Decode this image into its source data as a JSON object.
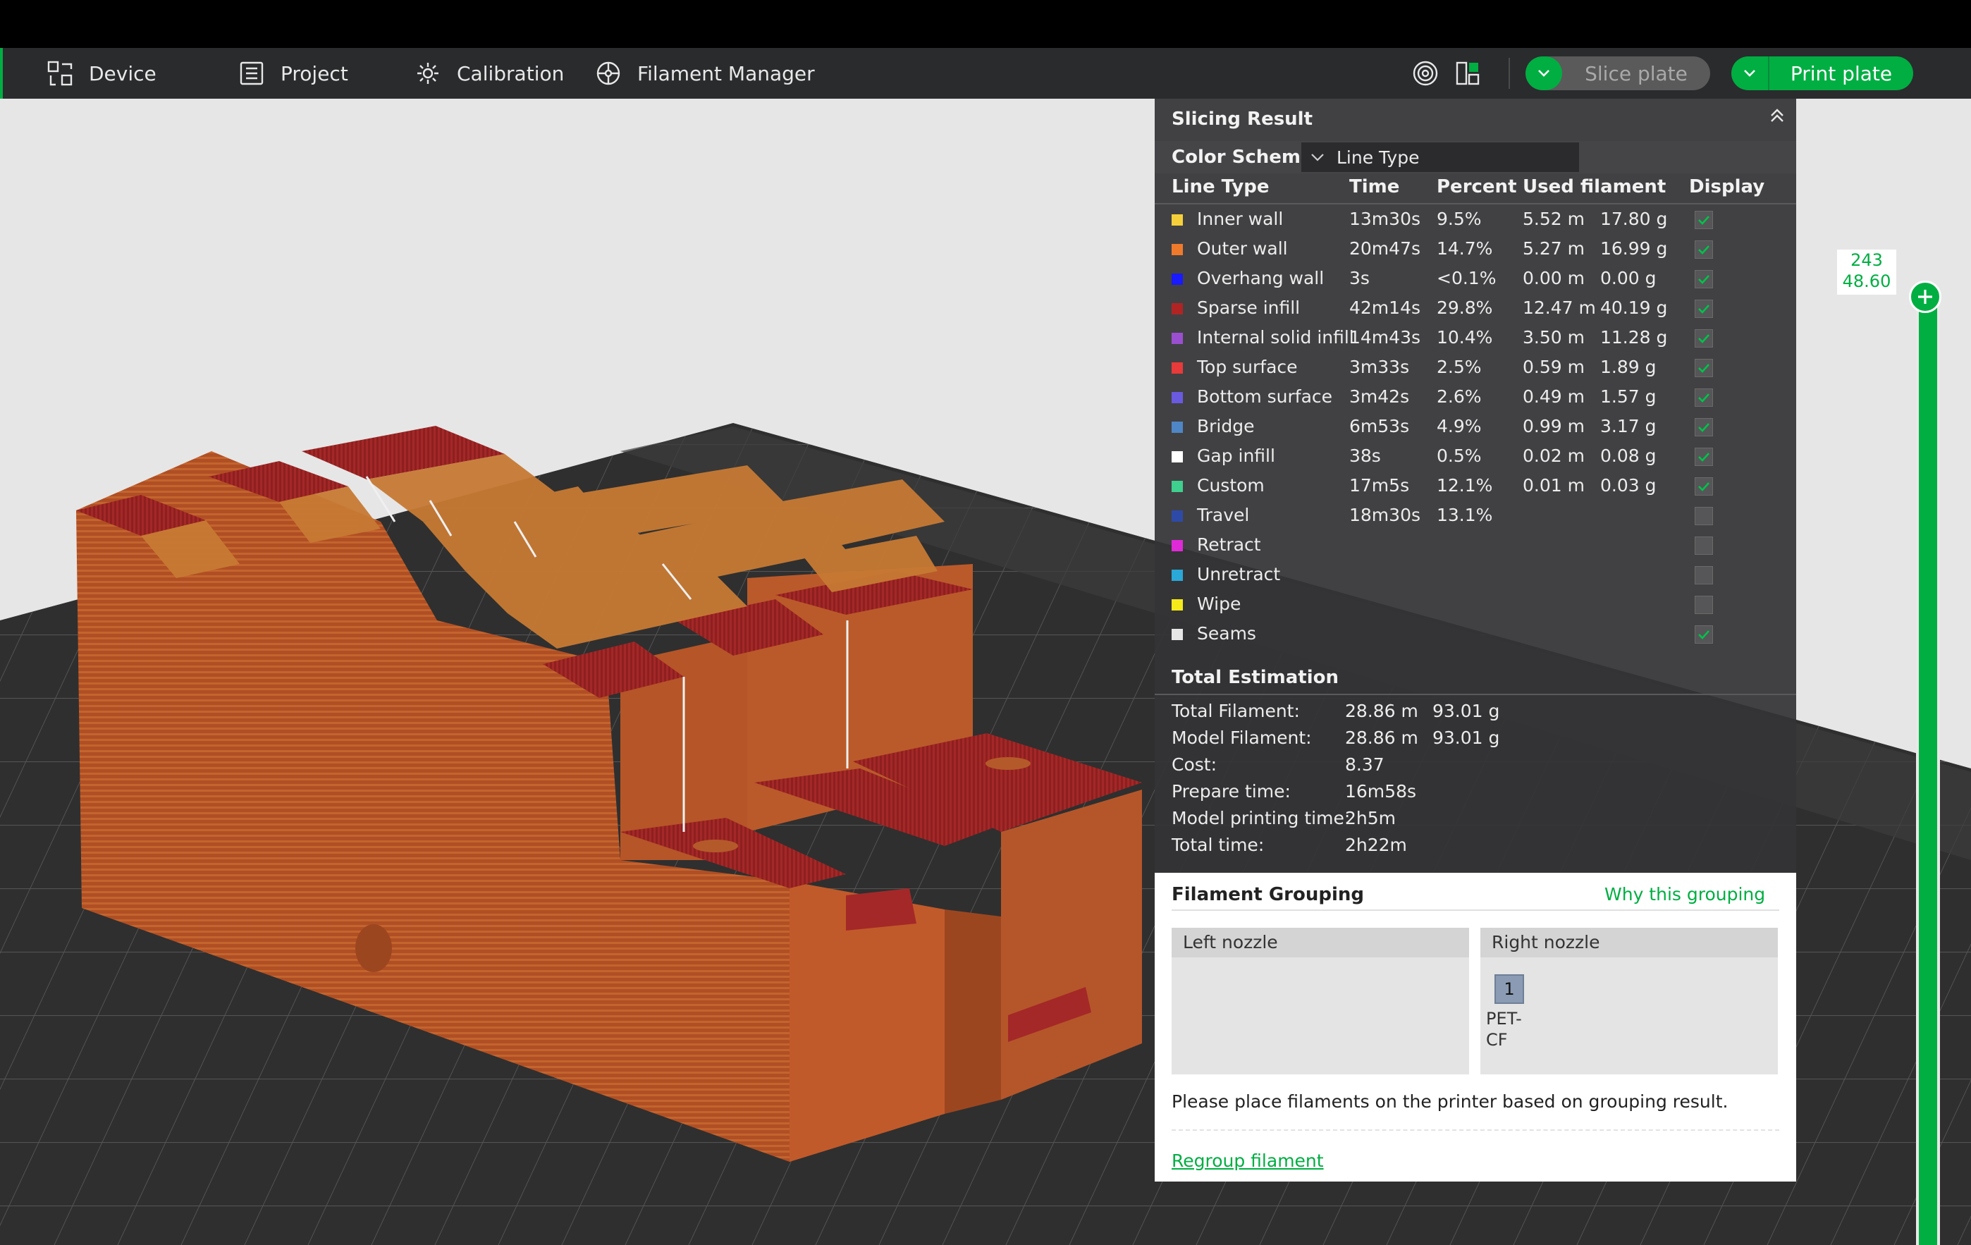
{
  "toolbar": {
    "device": "Device",
    "project": "Project",
    "calibration": "Calibration",
    "filament_manager": "Filament Manager",
    "slice_plate": "Slice plate",
    "print_plate": "Print plate"
  },
  "slicing_result": {
    "title": "Slicing Result",
    "color_scheme_label": "Color Scheme",
    "color_scheme_value": "Line Type",
    "columns": [
      "Line Type",
      "Time",
      "Percent",
      "Used filament",
      "Display"
    ],
    "rows": [
      {
        "name": "Inner wall",
        "color": "#f5d03a",
        "time": "13m30s",
        "percent": "9.5%",
        "length": "5.52 m",
        "weight": "17.80 g",
        "display": true
      },
      {
        "name": "Outer wall",
        "color": "#f07a2c",
        "time": "20m47s",
        "percent": "14.7%",
        "length": "5.27 m",
        "weight": "16.99 g",
        "display": true
      },
      {
        "name": "Overhang wall",
        "color": "#1a1aff",
        "time": "3s",
        "percent": "<0.1%",
        "length": "0.00 m",
        "weight": "0.00 g",
        "display": true
      },
      {
        "name": "Sparse infill",
        "color": "#b02424",
        "time": "42m14s",
        "percent": "29.8%",
        "length": "12.47 m",
        "weight": "40.19 g",
        "display": true
      },
      {
        "name": "Internal solid infill",
        "color": "#9a4fd0",
        "time": "14m43s",
        "percent": "10.4%",
        "length": "3.50 m",
        "weight": "11.28 g",
        "display": true
      },
      {
        "name": "Top surface",
        "color": "#e83a3a",
        "time": "3m33s",
        "percent": "2.5%",
        "length": "0.59 m",
        "weight": "1.89 g",
        "display": true
      },
      {
        "name": "Bottom surface",
        "color": "#6a5ae0",
        "time": "3m42s",
        "percent": "2.6%",
        "length": "0.49 m",
        "weight": "1.57 g",
        "display": true
      },
      {
        "name": "Bridge",
        "color": "#4f86c6",
        "time": "6m53s",
        "percent": "4.9%",
        "length": "0.99 m",
        "weight": "3.17 g",
        "display": true
      },
      {
        "name": "Gap infill",
        "color": "#ffffff",
        "time": "38s",
        "percent": "0.5%",
        "length": "0.02 m",
        "weight": "0.08 g",
        "display": true
      },
      {
        "name": "Custom",
        "color": "#3fcf8e",
        "time": "17m5s",
        "percent": "12.1%",
        "length": "0.01 m",
        "weight": "0.03 g",
        "display": true
      },
      {
        "name": "Travel",
        "color": "#2e4aa8",
        "time": "18m30s",
        "percent": "13.1%",
        "length": "",
        "weight": "",
        "display": false
      },
      {
        "name": "Retract",
        "color": "#e02ad8",
        "time": "",
        "percent": "",
        "length": "",
        "weight": "",
        "display": false
      },
      {
        "name": "Unretract",
        "color": "#2aa8d8",
        "time": "",
        "percent": "",
        "length": "",
        "weight": "",
        "display": false
      },
      {
        "name": "Wipe",
        "color": "#f5ea1a",
        "time": "",
        "percent": "",
        "length": "",
        "weight": "",
        "display": false
      },
      {
        "name": "Seams",
        "color": "#e6e6e6",
        "time": "",
        "percent": "",
        "length": "",
        "weight": "",
        "display": true
      }
    ]
  },
  "estimation": {
    "title": "Total Estimation",
    "rows": [
      {
        "label": "Total Filament:",
        "v1": "28.86 m",
        "v2": "93.01 g"
      },
      {
        "label": "Model Filament:",
        "v1": "28.86 m",
        "v2": "93.01 g"
      },
      {
        "label": "Cost:",
        "v1": "8.37",
        "v2": ""
      },
      {
        "label": "Prepare time:",
        "v1": "16m58s",
        "v2": ""
      },
      {
        "label": "Model printing time:",
        "v1": "2h5m",
        "v2": ""
      },
      {
        "label": "Total time:",
        "v1": "2h22m",
        "v2": ""
      }
    ]
  },
  "grouping": {
    "title": "Filament Grouping",
    "why_link": "Why this grouping",
    "left_nozzle": "Left nozzle",
    "right_nozzle": "Right nozzle",
    "filament_index": "1",
    "filament_name": "PET-CF",
    "instructions": "Please place filaments on the printer based on grouping result.",
    "regroup_link": "Regroup filament"
  },
  "layer_slider": {
    "layer": "243",
    "height": "48.60"
  },
  "colors": {
    "accent": "#00ae42",
    "model_orange": "#b5562a",
    "model_red": "#a42828"
  }
}
